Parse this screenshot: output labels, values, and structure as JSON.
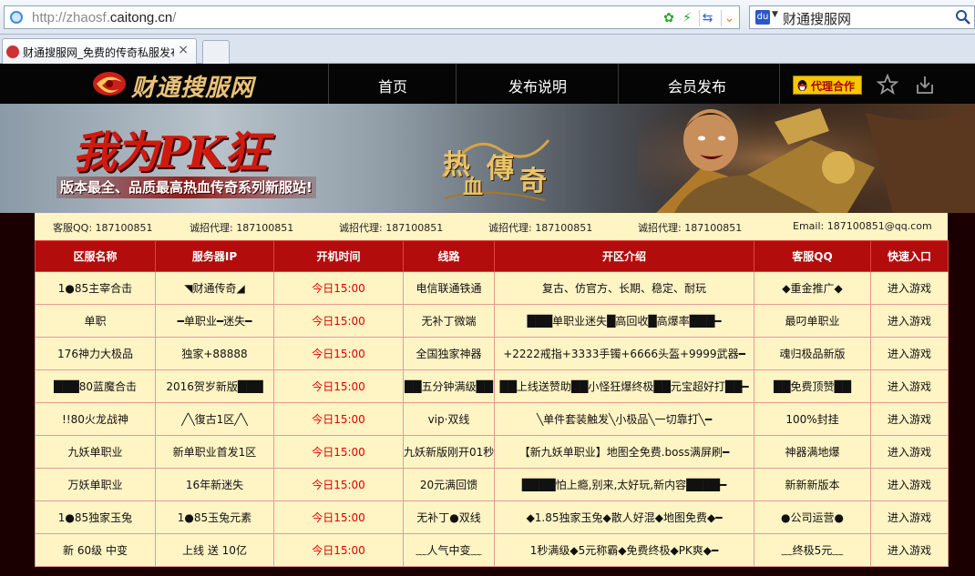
{
  "browser": {
    "url_prefix": "http://zhaosf.",
    "url_domain": "caitong.cn",
    "url_suffix": "/",
    "search_engine_text": "财通搜服网",
    "tab_title": "财通搜服网_免费的传奇私服发布"
  },
  "site": {
    "logo_text": "财通搜服网",
    "nav": [
      "首页",
      "发布说明",
      "会员发布"
    ],
    "agent_button": "代理合作",
    "banner_slogan": "我为PK狂",
    "banner_subtitle": "版本最全、品质最高热血传奇系列新服站!",
    "banner_game_title": [
      "热",
      "血",
      "傳",
      "奇"
    ]
  },
  "contact": [
    "客服QQ: 187100851",
    "诚招代理: 187100851",
    "诚招代理: 187100851",
    "诚招代理: 187100851",
    "诚招代理: 187100851",
    "Email: 187100851@qq.com"
  ],
  "table": {
    "headers": [
      "区服名称",
      "服务器IP",
      "开机时间",
      "线路",
      "开区介绍",
      "客服QQ",
      "快速入口"
    ],
    "rows": [
      [
        "1●85主宰合击",
        "◥财通传奇◢",
        "今日15:00",
        "电信联通铁通",
        "复古、仿官方、长期、稳定、耐玩",
        "◆重金推广◆",
        "进入游戏"
      ],
      [
        "单职",
        "━单职业━迷失━",
        "今日15:00",
        "无补丁微端",
        "███单职业迷失█高回收█高爆率███━",
        "最叼单职业",
        "进入游戏"
      ],
      [
        "176神力大极品",
        "独家+88888",
        "今日15:00",
        "全国独家神器",
        "+2222戒指+3333手镯+6666头盔+9999武器━",
        "魂归极品新版",
        "进入游戏"
      ],
      [
        "███80蓝魔合击",
        "2016贺岁新版███",
        "今日15:00",
        "██五分钟满级██",
        "██上线送赞助██小怪狂爆终极██元宝超好打██━",
        "██免费顶赞██",
        "进入游戏"
      ],
      [
        "!!80火龙战神",
        "╱╲復古1区╱╲",
        "今日15:00",
        "vip·双线",
        "╲单件套装触发╲小极品╲一切靠打╲━",
        "100%封挂",
        "进入游戏"
      ],
      [
        "九妖单职业",
        "新单职业首发1区",
        "今日15:00",
        "九妖新版刚开01秒",
        "【新九妖单职业】地图全免费.boss满屏刷━",
        "神器满地爆",
        "进入游戏"
      ],
      [
        "万妖单职业",
        "16年新迷失",
        "今日15:00",
        "20元满回馈",
        "████怕上瘾,别来,太好玩,新内容████━",
        "新新新版本",
        "进入游戏"
      ],
      [
        "1●85独家玉兔",
        "1●85玉兔元素",
        "今日15:00",
        "无补丁●双线",
        "◆1.85独家玉兔◆散人好混◆地图免费◆━",
        "●公司运营●",
        "进入游戏"
      ],
      [
        "新 60级 中变",
        "上线 送 10亿",
        "今日15:00",
        "﹏人气中变﹏",
        "1秒满级◆5元称霸◆免费终极◆PK爽◆━",
        "﹏终极5元﹏",
        "进入游戏"
      ]
    ]
  }
}
